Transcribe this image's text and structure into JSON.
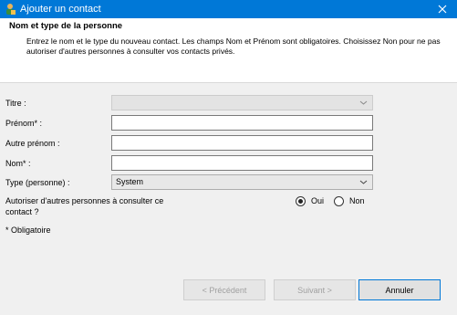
{
  "window": {
    "title": "Ajouter un contact"
  },
  "header": {
    "title": "Nom et type de la personne",
    "description": "Entrez le nom et le type du nouveau contact. Les champs Nom et Prénom sont obligatoires. Choisissez Non pour ne pas autoriser d'autres personnes à consulter vos contacts privés."
  },
  "form": {
    "titre_label": "Titre :",
    "titre_value": "",
    "prenom_label": "Prénom* :",
    "prenom_value": "",
    "autre_prenom_label": "Autre prénom :",
    "autre_prenom_value": "",
    "nom_label": "Nom* :",
    "nom_value": "",
    "type_label": "Type (personne) :",
    "type_value": "System",
    "authorize_label": "Autoriser d'autres personnes à consulter ce contact ?",
    "oui_label": "Oui",
    "non_label": "Non",
    "selected": "Oui",
    "required_note": "* Obligatoire"
  },
  "buttons": {
    "previous": "< Précédent",
    "next": "Suivant >",
    "cancel": "Annuler"
  },
  "colors": {
    "titlebar": "#0078d7",
    "header_bg": "#ffffff",
    "dialog_bg": "#f0f0f0"
  },
  "icons": {
    "app": "contact-person-icon",
    "close": "close-icon",
    "dropdown": "chevron-down-icon"
  }
}
